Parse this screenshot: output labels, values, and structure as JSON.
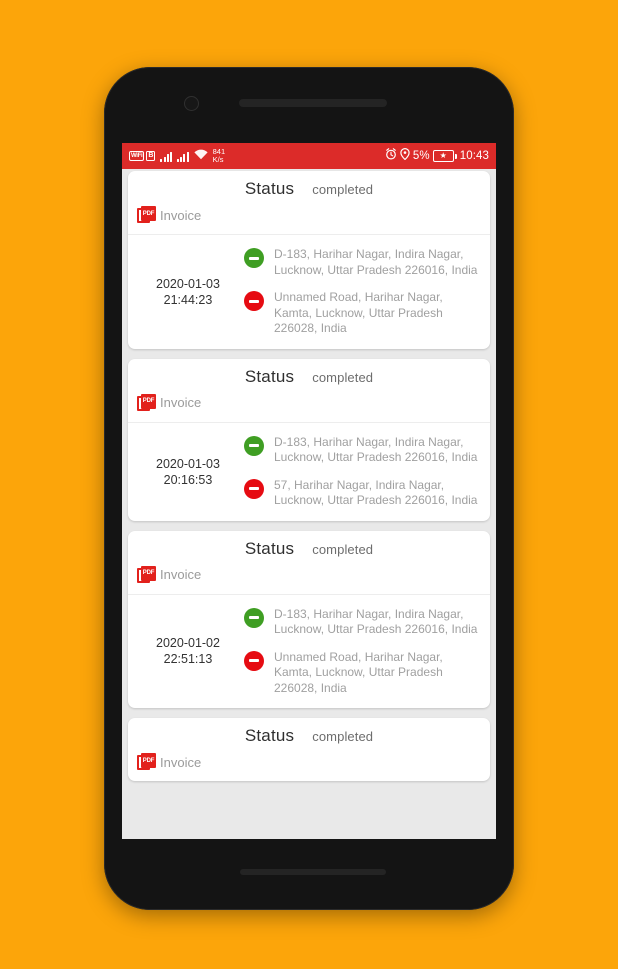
{
  "background_color": "#fca50a",
  "status_bar": {
    "background_color": "#dc2b29",
    "wifi_label": "WiFi",
    "wifi_badge": "B",
    "network_speed_value": "841",
    "network_speed_unit": "K/s",
    "alarm_icon": "alarm-clock-icon",
    "location_icon": "location-pin-icon",
    "battery_percent": "5%",
    "battery_icon": "battery-charging-icon",
    "clock": "10:43"
  },
  "cards": [
    {
      "status_label": "Status",
      "status_value": "completed",
      "invoice_label": "Invoice",
      "invoice_icon": "pdf-file-icon",
      "date": "2020-01-03",
      "time": "21:44:23",
      "pickup": "D-183, Harihar Nagar, Indira Nagar, Lucknow, Uttar Pradesh 226016, India",
      "dropoff": "Unnamed Road, Harihar Nagar, Kamta, Lucknow, Uttar Pradesh 226028, India",
      "pickup_color": "#3f9e23",
      "dropoff_color": "#e60b12"
    },
    {
      "status_label": "Status",
      "status_value": "completed",
      "invoice_label": "Invoice",
      "invoice_icon": "pdf-file-icon",
      "date": "2020-01-03",
      "time": "20:16:53",
      "pickup": "D-183, Harihar Nagar, Indira Nagar, Lucknow, Uttar Pradesh 226016, India",
      "dropoff": "57, Harihar Nagar, Indira Nagar, Lucknow, Uttar Pradesh 226016, India",
      "pickup_color": "#3f9e23",
      "dropoff_color": "#e60b12"
    },
    {
      "status_label": "Status",
      "status_value": "completed",
      "invoice_label": "Invoice",
      "invoice_icon": "pdf-file-icon",
      "date": "2020-01-02",
      "time": "22:51:13",
      "pickup": "D-183, Harihar Nagar, Indira Nagar, Lucknow, Uttar Pradesh 226016, India",
      "dropoff": "Unnamed Road, Harihar Nagar, Kamta, Lucknow, Uttar Pradesh 226028, India",
      "pickup_color": "#3f9e23",
      "dropoff_color": "#e60b12"
    },
    {
      "status_label": "Status",
      "status_value": "completed",
      "invoice_label": "Invoice",
      "invoice_icon": "pdf-file-icon",
      "date": "",
      "time": "",
      "pickup": "",
      "dropoff": "",
      "pickup_color": "#3f9e23",
      "dropoff_color": "#e60b12"
    }
  ]
}
